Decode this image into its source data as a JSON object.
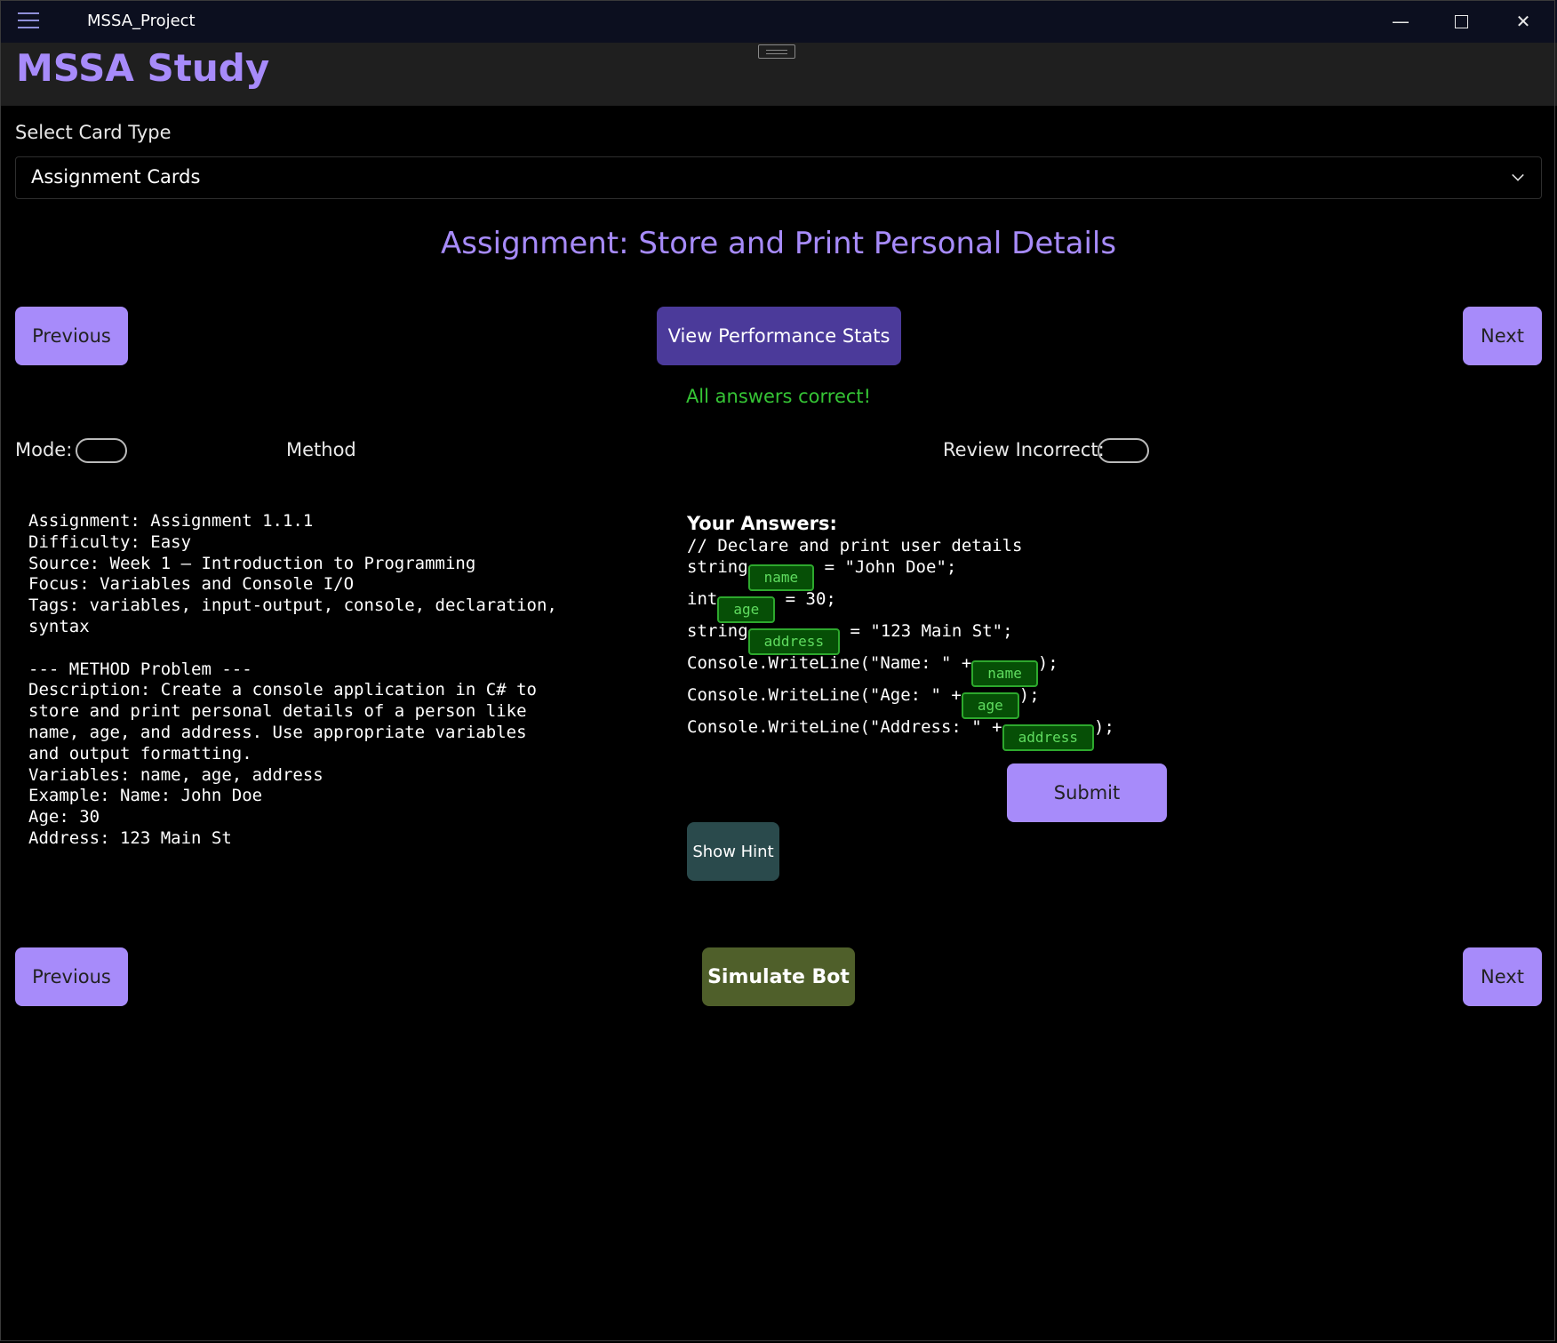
{
  "window": {
    "title": "MSSA_Project",
    "controls": [
      "minimize",
      "maximize",
      "close"
    ]
  },
  "header": {
    "brand": "MSSA Study"
  },
  "card_type": {
    "label": "Select Card Type",
    "selected": "Assignment Cards"
  },
  "assignment": {
    "heading": "Assignment: Store and Print Personal Details"
  },
  "nav": {
    "previous": "Previous",
    "next": "Next",
    "stats": "View Performance Stats",
    "simulate": "Simulate Bot"
  },
  "status": "All answers correct!",
  "mode": {
    "label": "Mode:",
    "value": "Method",
    "review_label": "Review Incorrect:"
  },
  "details": "Assignment: Assignment 1.1.1\nDifficulty: Easy\nSource: Week 1 – Introduction to Programming\nFocus: Variables and Console I/O\nTags: variables, input-output, console, declaration,\nsyntax\n\n--- METHOD Problem ---\nDescription: Create a console application in C# to\nstore and print personal details of a person like\nname, age, and address. Use appropriate variables\nand output formatting.\nVariables: name, age, address\nExample: Name: John Doe\nAge: 30\nAddress: 123 Main St",
  "answers": {
    "title": "Your Answers:",
    "comment": "// Declare and print user details",
    "lines": [
      {
        "before": "string",
        "answer": "name",
        "after": " = \"John Doe\";"
      },
      {
        "before": "int",
        "answer": "age",
        "after": " = 30;"
      },
      {
        "before": "string",
        "answer": "address",
        "after": " = \"123 Main St\";"
      },
      {
        "before": "Console.WriteLine(\"Name: \" +",
        "answer": "name",
        "after": ");"
      },
      {
        "before": "Console.WriteLine(\"Age: \" +",
        "answer": "age",
        "after": ");"
      },
      {
        "before": "Console.WriteLine(\"Address: \" +",
        "answer": "address",
        "after": ");"
      }
    ],
    "submit": "Submit",
    "hint": "Show Hint"
  },
  "colors": {
    "accent": "#a78bfa",
    "success": "#35c435",
    "answer_box": "#064f06"
  }
}
